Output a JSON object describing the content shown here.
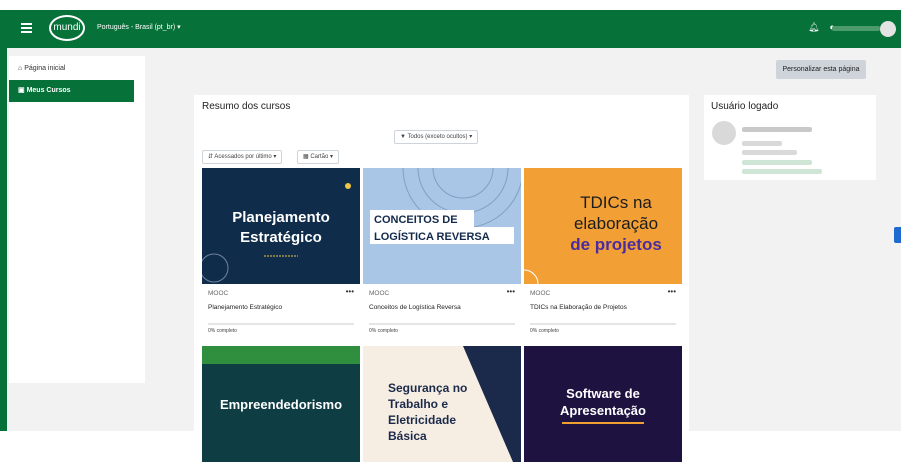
{
  "navbar": {
    "lang": "Português - Brasil (pt_br) ▾",
    "logo": "mundi",
    "icons": [
      "bell-icon",
      "chat-icon"
    ]
  },
  "sidebar": {
    "items": [
      {
        "label": "Página inicial",
        "icon": "home-icon",
        "active": false
      },
      {
        "label": "Meus Cursos",
        "icon": "courses-icon",
        "active": true
      }
    ]
  },
  "page": {
    "customize_label": "Personalizar esta página"
  },
  "overview": {
    "title": "Resumo dos cursos",
    "filter_label": "Todos (exceto ocultos) ▾",
    "sort_label": "Acessados por último ▾",
    "view_label": "Cartão ▾"
  },
  "courses": [
    {
      "category": "MOOC",
      "name": "Planejamento Estratégico",
      "progress_text": "0% completo",
      "image_lines": [
        "Planejamento",
        "Estratégico"
      ]
    },
    {
      "category": "MOOC",
      "name": "Conceitos de Logística Reversa",
      "progress_text": "0% completo",
      "image_lines": [
        "CONCEITOS DE",
        "LOGÍSTICA REVERSA"
      ]
    },
    {
      "category": "MOOC",
      "name": "TDICs na Elaboração de Projetos",
      "progress_text": "0% completo",
      "image_lines": [
        "TDICs na",
        "elaboração",
        "de projetos"
      ]
    },
    {
      "image_lines": [
        "Empreendedorismo"
      ]
    },
    {
      "image_lines": [
        "Segurança no",
        "Trabalho e",
        "Eletricidade",
        "Básica"
      ]
    },
    {
      "image_lines": [
        "Software de",
        "Apresentação"
      ]
    }
  ],
  "user_panel": {
    "title": "Usuário logado"
  },
  "colors": {
    "brand": "#067139",
    "page_bg": "#f2f2f2"
  }
}
